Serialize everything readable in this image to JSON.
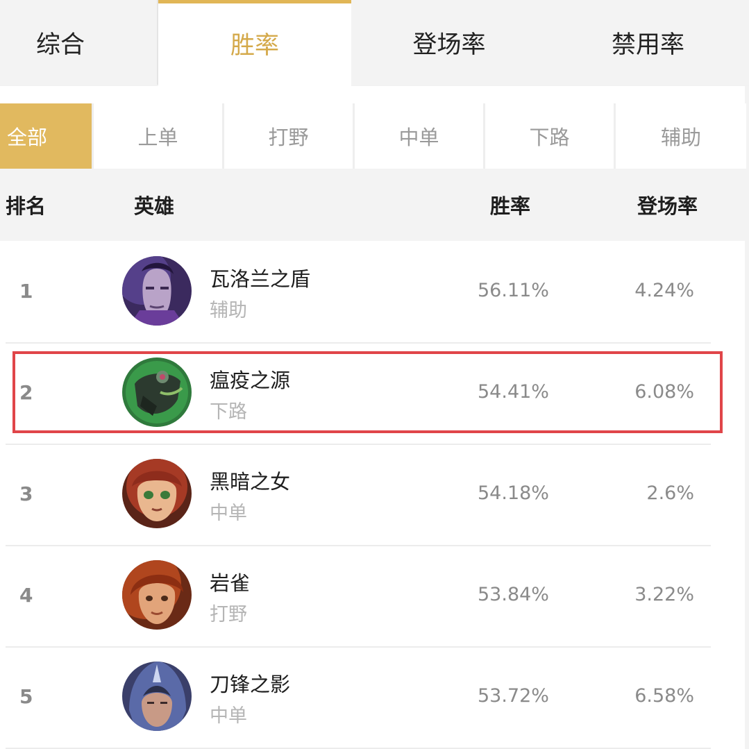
{
  "tabs": [
    {
      "label": "综合",
      "active": false
    },
    {
      "label": "胜率",
      "active": true
    },
    {
      "label": "登场率",
      "active": false
    },
    {
      "label": "禁用率",
      "active": false
    }
  ],
  "positions": [
    {
      "label": "全部",
      "active": true
    },
    {
      "label": "上单",
      "active": false
    },
    {
      "label": "打野",
      "active": false
    },
    {
      "label": "中单",
      "active": false
    },
    {
      "label": "下路",
      "active": false
    },
    {
      "label": "辅助",
      "active": false
    }
  ],
  "table": {
    "headers": {
      "rank": "排名",
      "hero": "英雄",
      "winrate": "胜率",
      "pickrate": "登场率"
    },
    "rows": [
      {
        "rank": "1",
        "name": "瓦洛兰之盾",
        "role": "辅助",
        "winrate": "56.11%",
        "pickrate": "4.24%",
        "avatar": "tahm-kench-portrait"
      },
      {
        "rank": "2",
        "name": "瘟疫之源",
        "role": "下路",
        "winrate": "54.41%",
        "pickrate": "6.08%",
        "avatar": "twitch-portrait",
        "highlighted": true
      },
      {
        "rank": "3",
        "name": "黑暗之女",
        "role": "中单",
        "winrate": "54.18%",
        "pickrate": "2.6%",
        "avatar": "annie-portrait"
      },
      {
        "rank": "4",
        "name": "岩雀",
        "role": "打野",
        "winrate": "53.84%",
        "pickrate": "3.22%",
        "avatar": "taliyah-portrait"
      },
      {
        "rank": "5",
        "name": "刀锋之影",
        "role": "中单",
        "winrate": "53.72%",
        "pickrate": "6.58%",
        "avatar": "talon-portrait"
      }
    ]
  },
  "colors": {
    "accent": "#e1b95f",
    "accent_text": "#d4a94a",
    "highlight_border": "#e04549"
  }
}
